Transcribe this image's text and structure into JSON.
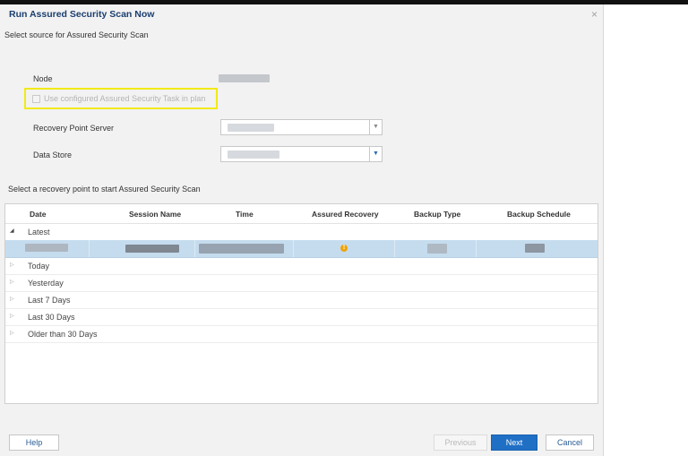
{
  "dialog": {
    "title": "Run Assured Security Scan Now",
    "close_glyph": "×",
    "subtitle": "Select source for Assured Security Scan"
  },
  "form": {
    "node_label": "Node",
    "use_configured_label": "Use configured Assured Security Task in plan",
    "use_configured_checked": false,
    "recovery_point_server_label": "Recovery Point Server",
    "data_store_label": "Data Store",
    "combo_arrow": "▼"
  },
  "grid": {
    "section_label": "Select a recovery point to start Assured Security Scan",
    "columns": [
      "Date",
      "Session Name",
      "Time",
      "Assured Recovery",
      "Backup Type",
      "Backup Schedule"
    ],
    "groups": [
      {
        "label": "Latest",
        "expanded": true
      },
      {
        "label": "Today",
        "expanded": false
      },
      {
        "label": "Yesterday",
        "expanded": false
      },
      {
        "label": "Last 7 Days",
        "expanded": false
      },
      {
        "label": "Last 30 Days",
        "expanded": false
      },
      {
        "label": "Older than 30 Days",
        "expanded": false
      }
    ],
    "expanded_glyph": "◢",
    "collapsed_glyph": "▷",
    "warning_glyph": "!"
  },
  "footer": {
    "help": "Help",
    "previous": "Previous",
    "next": "Next",
    "cancel": "Cancel"
  },
  "colors": {
    "title": "#1a3e6e",
    "highlight_border": "#f1ea18",
    "selected_row": "#c5dcef",
    "next_button": "#1f6fc5",
    "warning": "#f0a30a"
  },
  "icons": [
    "close-icon",
    "chevron-down-icon",
    "expand-triangle-icon",
    "collapse-triangle-icon",
    "warning-icon"
  ]
}
